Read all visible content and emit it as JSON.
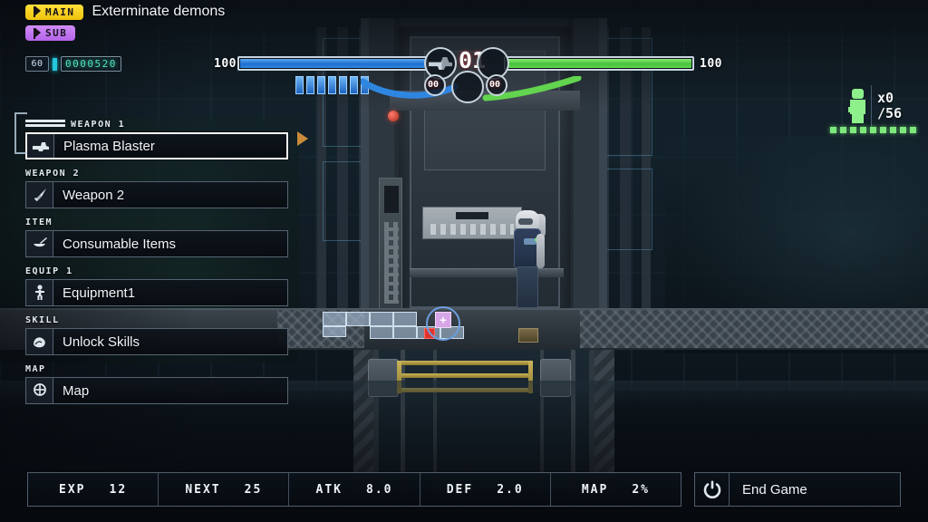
{
  "quest": {
    "main_badge": "MAIN",
    "sub_badge": "SUB",
    "title": "Exterminate demons"
  },
  "hud": {
    "timer": "60",
    "score": "0000520",
    "left_bar_label": "100",
    "right_bar_label": "100",
    "left_bar_value": 100,
    "right_bar_value": 100,
    "left_bar_color": "#2f86e0",
    "right_bar_color": "#62d44f",
    "ammo_primary": "01",
    "ammo_left": "00",
    "ammo_right": "00",
    "pip_count": 7,
    "enemy_count": "x0",
    "enemy_total": "/56",
    "dot_count": 9
  },
  "menu": {
    "groups": [
      {
        "category": "WEAPON 1",
        "label": "Plasma Blaster",
        "icon": "blaster-icon",
        "selected": true
      },
      {
        "category": "WEAPON 2",
        "label": "Weapon 2",
        "icon": "sword-icon",
        "selected": false
      },
      {
        "category": "ITEM",
        "label": "Consumable Items",
        "icon": "potion-icon",
        "selected": false
      },
      {
        "category": "EQUIP 1",
        "label": "Equipment1",
        "icon": "person-icon",
        "selected": false
      },
      {
        "category": "SKILL",
        "label": "Unlock Skills",
        "icon": "muscle-icon",
        "selected": false
      },
      {
        "category": "MAP",
        "label": "Map",
        "icon": "map-pin-icon",
        "selected": false
      }
    ]
  },
  "stats": [
    {
      "key": "EXP",
      "value": "12"
    },
    {
      "key": "NEXT",
      "value": "25"
    },
    {
      "key": "ATK",
      "value": "8.0"
    },
    {
      "key": "DEF",
      "value": "2.0"
    },
    {
      "key": "MAP",
      "value": "2%"
    }
  ],
  "end_game": {
    "label": "End Game",
    "icon": "power-icon"
  },
  "minimap": {
    "save_marker": "+"
  },
  "colors": {
    "main_badge": "#f0c30c",
    "sub_badge": "#b463ea",
    "accent_cursor": "#c98a3a",
    "score_green": "#4fe6c0",
    "enemy_green": "#8df08b"
  }
}
